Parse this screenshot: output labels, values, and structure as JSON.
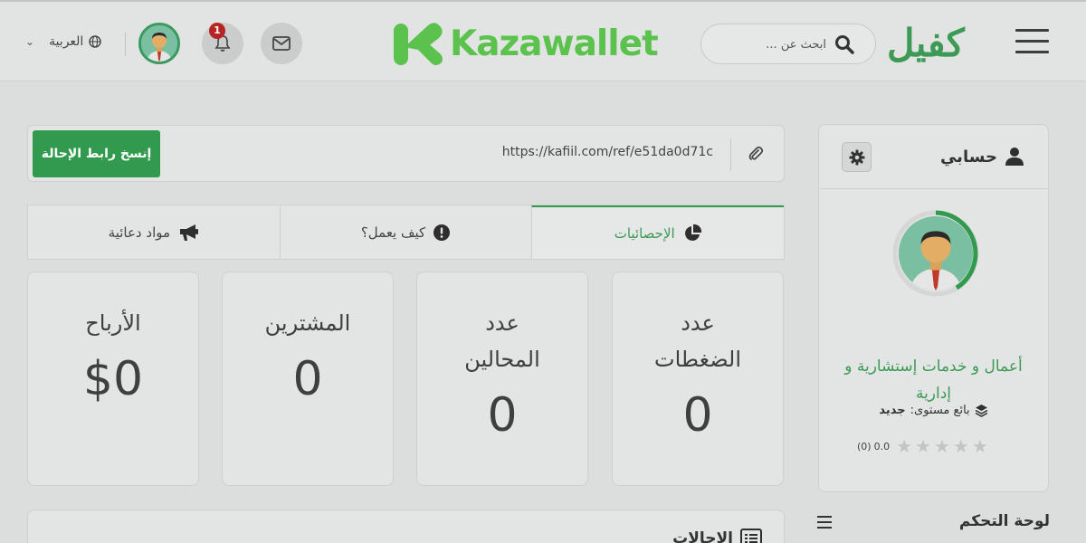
{
  "header": {
    "brand": "كفيل",
    "search_placeholder": "ابحث عن ...",
    "partner_logo": "Kazawallet",
    "notifications_count": "1",
    "language": "العربية",
    "icons": {
      "menu": "hamburger-icon",
      "search": "search-icon",
      "mail": "envelope-icon",
      "bell": "bell-icon",
      "globe": "globe-icon",
      "chevron": "chevron-down-icon"
    }
  },
  "sidebar": {
    "title": "حسابي",
    "seller_name": "أعمال و خدمات إستشارية و إدارية",
    "level_label": "بائع مستوى:",
    "level_value": "جديد",
    "rating_score": "0.0",
    "rating_count": "(0)",
    "stars_filled": 0,
    "stars_total": 5,
    "dashboard_title": "لوحة التحكم"
  },
  "referral": {
    "url": "https://kafiil.com/ref/e51da0d71c",
    "copy_button": "إنسخ رابط الإحالة"
  },
  "tabs": [
    {
      "label": "الإحصائيات",
      "icon": "pie-chart-icon",
      "active": true
    },
    {
      "label": "كيف يعمل؟",
      "icon": "info-icon",
      "active": false
    },
    {
      "label": "مواد دعائية",
      "icon": "megaphone-icon",
      "active": false
    }
  ],
  "stats": [
    {
      "label": "عدد الضغطات",
      "value": "0"
    },
    {
      "label": "عدد المحالين",
      "value": "0"
    },
    {
      "label": "المشترين",
      "value": "0"
    },
    {
      "label": "الأرباح",
      "value": "$0"
    }
  ],
  "referrals_panel": {
    "title": "الإحالات"
  },
  "colors": {
    "brand_green": "#319a4e",
    "kaza_green": "#5bc24e",
    "badge_red": "#b82424"
  }
}
